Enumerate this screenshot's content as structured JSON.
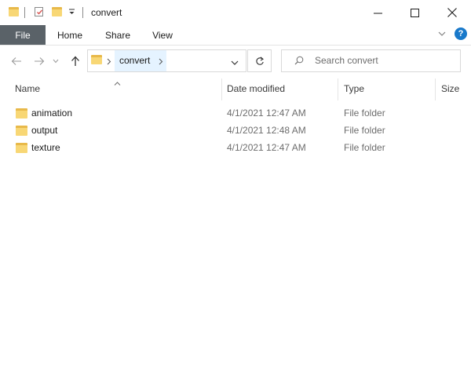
{
  "window": {
    "title": "convert"
  },
  "ribbon": {
    "tabs": [
      {
        "label": "File"
      },
      {
        "label": "Home"
      },
      {
        "label": "Share"
      },
      {
        "label": "View"
      }
    ]
  },
  "address": {
    "crumbs": [
      {
        "label": "convert"
      }
    ]
  },
  "search": {
    "placeholder": "Search convert"
  },
  "columns": {
    "name": "Name",
    "date_modified": "Date modified",
    "type": "Type",
    "size": "Size"
  },
  "files": [
    {
      "name": "animation",
      "date": "4/1/2021 12:47 AM",
      "type": "File folder"
    },
    {
      "name": "output",
      "date": "4/1/2021 12:48 AM",
      "type": "File folder"
    },
    {
      "name": "texture",
      "date": "4/1/2021 12:47 AM",
      "type": "File folder"
    }
  ],
  "colors": {
    "file_tab_bg": "#5a6268",
    "folder_yellow": "#f8d775",
    "help_blue": "#1979ca",
    "selection_blue": "#e5f3ff"
  },
  "icons": [
    "folder-icon",
    "properties-icon",
    "dropdown-icon",
    "minimize-icon",
    "maximize-icon",
    "close-icon",
    "back-icon",
    "forward-icon",
    "recent-icon",
    "up-icon",
    "chevron-right-icon",
    "chevron-down-icon",
    "refresh-icon",
    "search-icon",
    "sort-up-icon",
    "help-icon"
  ]
}
